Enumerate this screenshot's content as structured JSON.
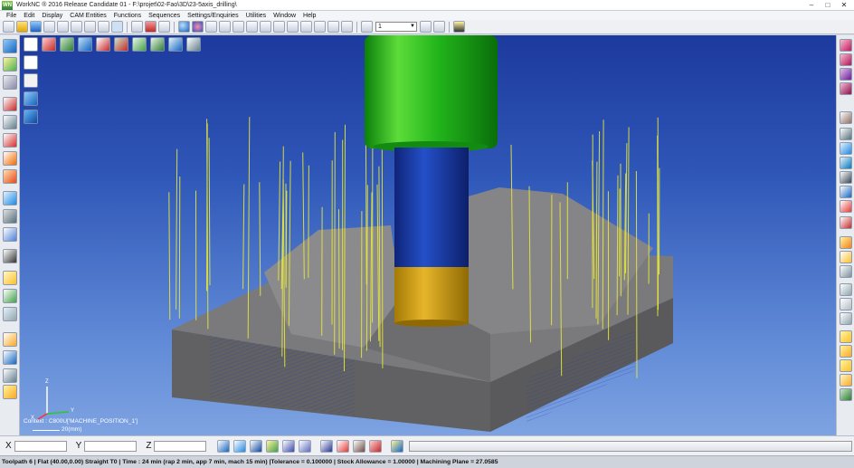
{
  "window": {
    "title": "WorkNC ® 2016 Release Candidate 01 - F:\\projet\\02-Fao\\3D\\23-5axis_drilling\\",
    "logo_text": "WN",
    "minimize": "–",
    "maximize": "□",
    "close": "✕"
  },
  "menu": {
    "items": [
      "File",
      "Edit",
      "Display",
      "CAM Entities",
      "Functions",
      "Sequences",
      "Settings/Enquiries",
      "Utilities",
      "Window",
      "Help"
    ]
  },
  "toolbar": {
    "layer_select_value": "1"
  },
  "viewport": {
    "context_label": "Context : C800U['MACHINE_POSITION_1']",
    "scale_label": "20(mm)",
    "axes": {
      "z": "Z",
      "y": "Y",
      "x": "X"
    },
    "colors": {
      "background_top": "#1d3a9e",
      "background_bottom": "#7ea3e2",
      "part": "#6e6e70",
      "tool_holder": "#1fa51c",
      "tool_shank": "#1e3fae",
      "tool_tip": "#d4a512",
      "toolpath": "#e8e83a"
    }
  },
  "coords": {
    "x_label": "X",
    "y_label": "Y",
    "z_label": "Z",
    "x_value": "",
    "y_value": "",
    "z_value": ""
  },
  "status": {
    "text": "Toolpath 6 | Flat (40.00,0.00) Straight T0 | Time : 24 min (rap 2 min, app 7 min, mach 15 min) |Tolerance = 0.100000 | Stock Allowance = 1.00000 | Machining Plane = 27.0585"
  }
}
